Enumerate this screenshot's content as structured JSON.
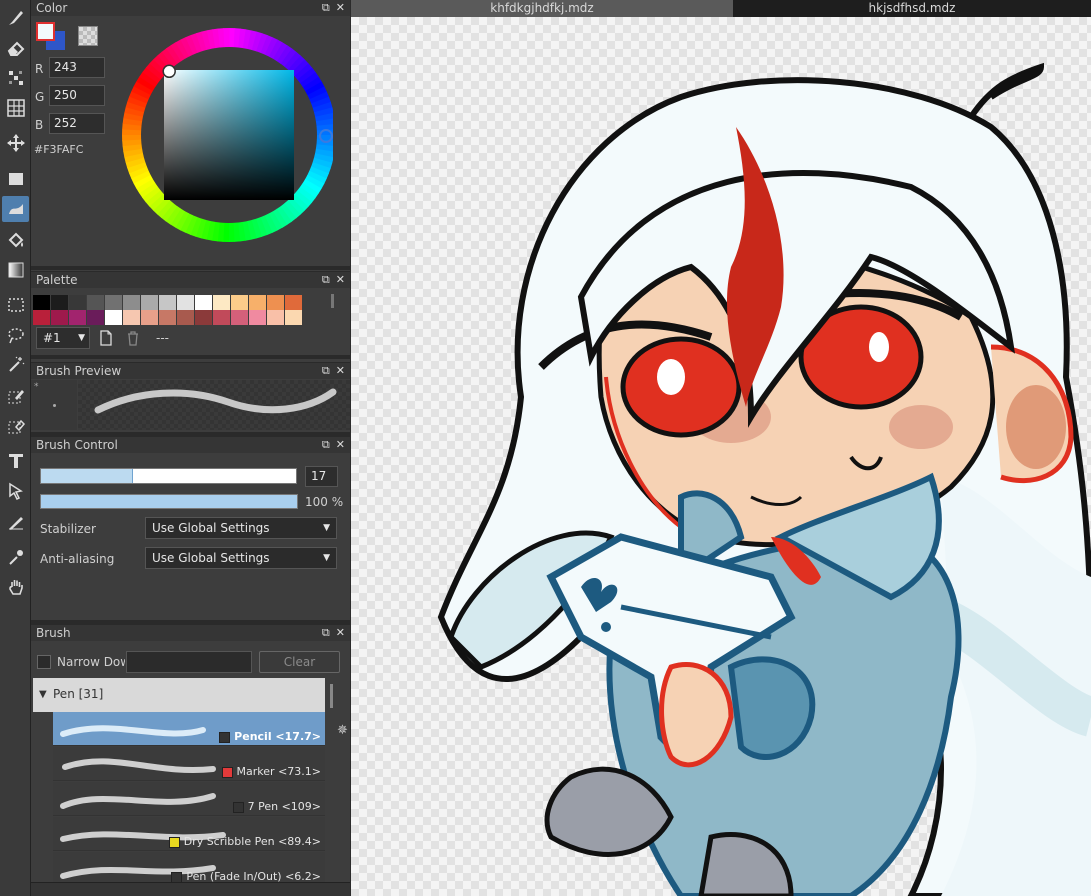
{
  "tabs": [
    {
      "label": "khfdkgjhdfkj.mdz",
      "active": true
    },
    {
      "label": "hkjsdfhsd.mdz",
      "active": false
    }
  ],
  "panels": {
    "color": {
      "title": "Color",
      "float_icon": "⧉",
      "close_icon": "✕"
    },
    "palette": {
      "title": "Palette"
    },
    "brush_preview": {
      "title": "Brush Preview"
    },
    "brush_control": {
      "title": "Brush Control"
    },
    "brush": {
      "title": "Brush"
    }
  },
  "color": {
    "fg_hex": "#f3fafc",
    "bg_hex": "#2e56c8",
    "r_label": "R",
    "r": "243",
    "g_label": "G",
    "g": "250",
    "b_label": "B",
    "b": "252",
    "hex": "#F3FAFC",
    "hue": 195,
    "saturation": 0.04,
    "value": 0.99
  },
  "palette": {
    "row1": [
      "#000000",
      "#1c1c1c",
      "#383838",
      "#555555",
      "#717171",
      "#8d8d8d",
      "#aaaaaa",
      "#c6c6c6",
      "#e2e2e2",
      "#ffffff",
      "#fde9c4",
      "#fccc8a",
      "#f7b06a",
      "#ee9050",
      "#e06a3a"
    ],
    "row2": [
      "#b9203a",
      "#9e1a4c",
      "#a2246e",
      "#6a1c5a",
      "#ffffff",
      "#f6c7b0",
      "#e8a08a",
      "#c77866",
      "#a85a4e",
      "#8b3a3a",
      "#c14a5a",
      "#d4607a",
      "#f08aa0",
      "#f9c0a8",
      "#fbd8b0"
    ],
    "selector": "#1",
    "name": "---"
  },
  "brush_control": {
    "size": "17",
    "size_fraction": 0.36,
    "opacity": "100 %",
    "opacity_fraction": 1.0,
    "stabilizer_label": "Stabilizer",
    "stabilizer_value": "Use Global Settings",
    "antialias_label": "Anti-aliasing",
    "antialias_value": "Use Global Settings"
  },
  "brush": {
    "narrow_label": "Narrow Dow",
    "clear_label": "Clear",
    "group_label": "Pen [31]",
    "items": [
      {
        "name": "Pencil <17.7>",
        "color": "#333333",
        "selected": true
      },
      {
        "name": "Marker <73.1>",
        "color": "#e23a3a",
        "selected": false
      },
      {
        "name": "7 Pen <109>",
        "color": "#333333",
        "selected": false
      },
      {
        "name": "Dry Scribble Pen <89.4>",
        "color": "#e8d820",
        "selected": false
      },
      {
        "name": "Pen (Fade In/Out) <6.2>",
        "color": "#333333",
        "selected": false
      }
    ]
  },
  "icons": {
    "tools": [
      "brush-icon",
      "eraser-icon",
      "dither-icon",
      "grid-icon",
      "move-icon",
      "rectangle-icon",
      "gradient-brush-icon",
      "fill-bucket-icon",
      "gradient-icon",
      "select-rect-icon",
      "lasso-icon",
      "magic-wand-icon",
      "select-pen-icon",
      "select-eraser-icon",
      "text-icon",
      "operation-icon",
      "divide-icon",
      "eyedropper-icon",
      "hand-icon"
    ]
  }
}
